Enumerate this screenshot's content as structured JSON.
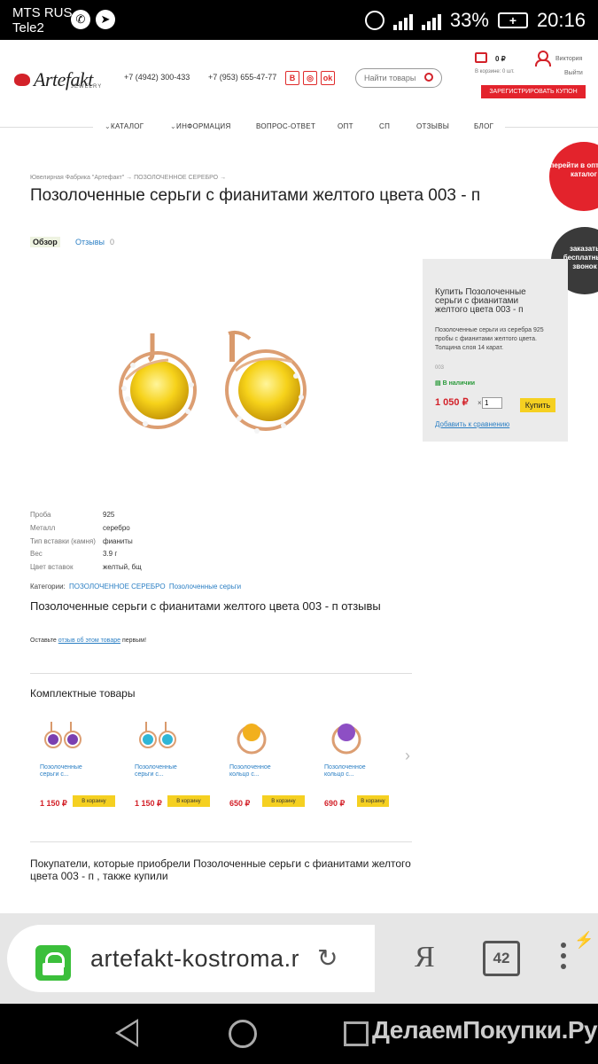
{
  "statusbar": {
    "carrier1": "MTS RUS",
    "carrier2": "Tele2",
    "battery": "33%",
    "time": "20:16"
  },
  "header": {
    "logo": "Artefakt",
    "logo_sub": "JEWELRY",
    "phone1": "+7 (4942) 300-433",
    "phone2": "+7 (953) 655-47-77",
    "social": [
      "В",
      "◎",
      "ok"
    ],
    "search_placeholder": "Найти товары",
    "cart_sum": "0 ₽",
    "cart_count": "В корзине: 0 шт.",
    "user_name": "Виктория",
    "logout": "Выйти",
    "coupon_button": "ЗАРЕГИСТРИРОВАТЬ КУПОН"
  },
  "nav": [
    "КАТАЛОГ",
    "ИНФОРМАЦИЯ",
    "ВОПРОС-ОТВЕТ",
    "ОПТ",
    "СП",
    "ОТЗЫВЫ",
    "БЛОГ"
  ],
  "badges": {
    "wholesale": "перейти в оптовый каталог",
    "callback": "заказать бесплатный звонок"
  },
  "breadcrumbs": "Ювелирная Фабрика \"Артефакт\" → ПОЗОЛОЧЕННОЕ СЕРЕБРО →",
  "product": {
    "title": "Позолоченные серьги с фианитами желтого цвета 003 - п",
    "tab_overview": "Обзор",
    "tab_reviews": "Отзывы",
    "reviews_count": "0"
  },
  "buybox": {
    "title": "Купить Позолоченные серьги с фианитами желтого цвета 003 - п",
    "description": "Позолоченные серьги из серебра 925 пробы с фианитами желтого цвета. Толщина слоя 14 карат.",
    "sku": "003",
    "stock": "В наличии",
    "price": "1 050 ₽",
    "x": "×",
    "qty": "1",
    "buy_label": "Купить",
    "compare_label": "Добавить к сравнению"
  },
  "specs": [
    {
      "k": "Проба",
      "v": "925"
    },
    {
      "k": "Металл",
      "v": "серебро"
    },
    {
      "k": "Тип вставки (камня)",
      "v": "фианиты"
    },
    {
      "k": "Вес",
      "v": "3.9 г"
    },
    {
      "k": "Цвет вставок",
      "v": "желтый, бщ"
    }
  ],
  "categories": {
    "label": "Категории:",
    "items": [
      "ПОЗОЛОЧЕННОЕ СЕРЕБРО",
      "Позолоченные серьги"
    ]
  },
  "reviews": {
    "title": "Позолоченные серьги с фианитами желтого цвета 003 - п отзывы",
    "note_before": "Оставьте",
    "note_link": "отзыв об этом товаре",
    "note_after": "первым!"
  },
  "related": {
    "title": "Комплектные товары",
    "items": [
      {
        "name": "Позолоченные серьги с...",
        "price": "1 150 ₽",
        "button": "В корзину",
        "color": "#7a3fb0"
      },
      {
        "name": "Позолоченные серьги с...",
        "price": "1 150 ₽",
        "button": "В корзину",
        "color": "#2fb6d6"
      },
      {
        "name": "Позолоченное кольцо с...",
        "price": "650 ₽",
        "button": "В корзину",
        "color": "#f2b01e"
      },
      {
        "name": "Позолоченное кольцо с...",
        "price": "690 ₽",
        "button": "В корзину",
        "color": "#8d4fc4"
      }
    ]
  },
  "also_bought": {
    "title": "Покупатели, которые приобрели Позолоченные серьги с фианитами желтого цвета 003 - п , также купили"
  },
  "browser": {
    "url": "artefakt-kostroma.r",
    "ya": "Я",
    "tabs": "42"
  },
  "watermark": "ДелаемПокупки.Ру"
}
